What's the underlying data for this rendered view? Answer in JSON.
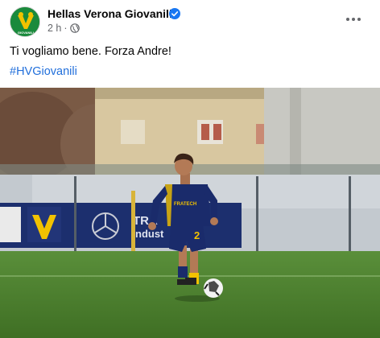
{
  "post": {
    "author": "Hellas Verona Giovanili",
    "time": "2 h",
    "separator": "·",
    "text": "Ti vogliamo bene. Forza Andre!",
    "hashtag": "#HVGiovanili"
  },
  "avatar_label": "GIOVANILI",
  "photo": {
    "banner_text": "TRA",
    "banner_text2": "ndust",
    "jersey_number": "2",
    "sponsor": "FRATECH"
  },
  "colors": {
    "verified": "#1877f2",
    "hashtag": "#216fdb",
    "avatar_bg": "#1a8a3c",
    "kit_blue": "#1a2b6b",
    "kit_yellow": "#f2c200"
  },
  "icons": {
    "verified": "verified-badge-icon",
    "privacy": "globe-icon",
    "menu": "more-options-icon"
  }
}
